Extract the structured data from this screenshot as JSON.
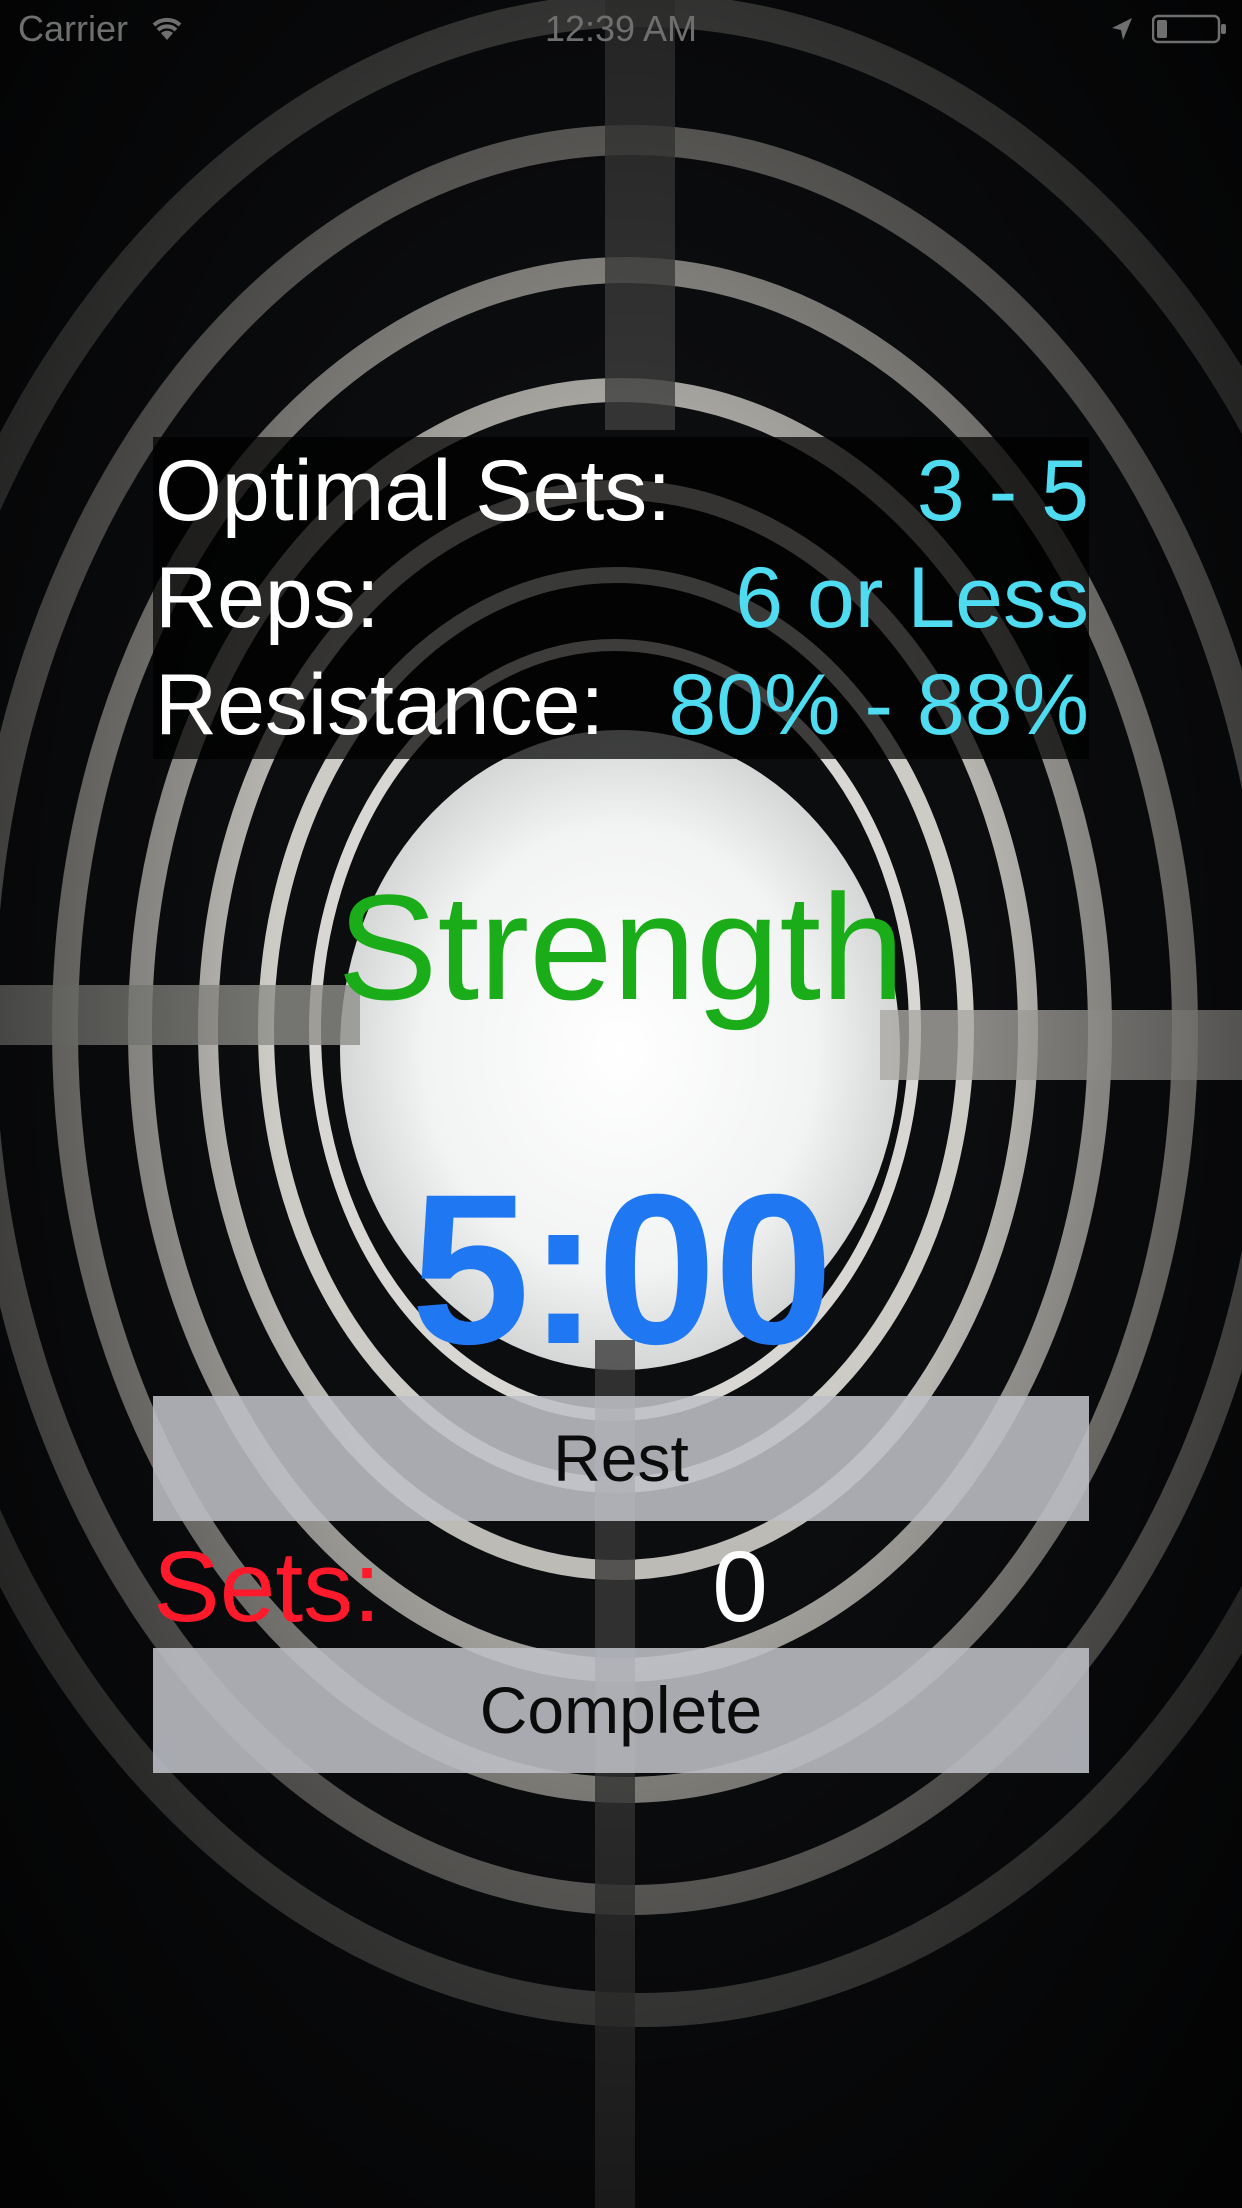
{
  "status_bar": {
    "carrier": "Carrier",
    "time": "12:39 AM"
  },
  "info": {
    "sets_label": "Optimal Sets:",
    "sets_value": "3 - 5",
    "reps_label": "Reps:",
    "reps_value": "6 or Less",
    "resistance_label": "Resistance:",
    "resistance_value": "80% - 88%"
  },
  "mode_title": "Strength",
  "timer": "5:00",
  "rest_button": "Rest",
  "sets": {
    "label": "Sets:",
    "count": "0"
  },
  "complete_button": "Complete",
  "colors": {
    "value_cyan": "#4fdcf0",
    "title_green": "#1aad19",
    "timer_blue": "#1f78f2",
    "sets_red": "#ff1a2b",
    "button_gray": "#bec0c7"
  },
  "icons": [
    "wifi-icon",
    "location-icon",
    "battery-icon"
  ]
}
